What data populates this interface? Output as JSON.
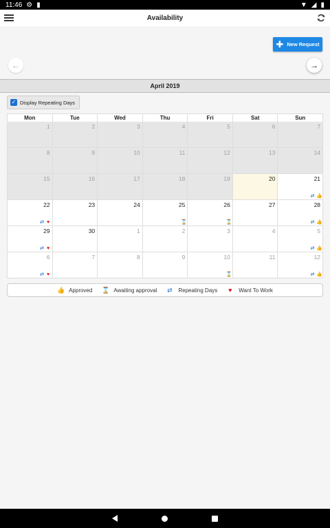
{
  "status_bar": {
    "time": "11:46"
  },
  "app_bar": {
    "title": "Availability"
  },
  "new_request_label": "New Request",
  "month_title": "April 2019",
  "display_repeating_label": "Display Repeating Days",
  "weekdays": [
    "Mon",
    "Tue",
    "Wed",
    "Thu",
    "Fri",
    "Sat",
    "Sun"
  ],
  "weeks": [
    [
      {
        "day": "1",
        "faded": true,
        "state": "grey",
        "icons": []
      },
      {
        "day": "2",
        "faded": true,
        "state": "grey",
        "icons": []
      },
      {
        "day": "3",
        "faded": true,
        "state": "grey",
        "icons": []
      },
      {
        "day": "4",
        "faded": true,
        "state": "grey",
        "icons": []
      },
      {
        "day": "5",
        "faded": true,
        "state": "grey",
        "icons": []
      },
      {
        "day": "6",
        "faded": true,
        "state": "grey",
        "icons": []
      },
      {
        "day": "7",
        "faded": true,
        "state": "grey",
        "icons": []
      }
    ],
    [
      {
        "day": "8",
        "faded": true,
        "state": "grey",
        "icons": []
      },
      {
        "day": "9",
        "faded": true,
        "state": "grey",
        "icons": []
      },
      {
        "day": "10",
        "faded": true,
        "state": "grey",
        "icons": []
      },
      {
        "day": "11",
        "faded": true,
        "state": "grey",
        "icons": []
      },
      {
        "day": "12",
        "faded": true,
        "state": "grey",
        "icons": []
      },
      {
        "day": "13",
        "faded": true,
        "state": "grey",
        "icons": []
      },
      {
        "day": "14",
        "faded": true,
        "state": "grey",
        "icons": []
      }
    ],
    [
      {
        "day": "15",
        "faded": true,
        "state": "grey",
        "icons": []
      },
      {
        "day": "16",
        "faded": true,
        "state": "grey",
        "icons": []
      },
      {
        "day": "17",
        "faded": true,
        "state": "grey",
        "icons": []
      },
      {
        "day": "18",
        "faded": true,
        "state": "grey",
        "icons": []
      },
      {
        "day": "19",
        "faded": true,
        "state": "grey",
        "icons": []
      },
      {
        "day": "20",
        "faded": false,
        "state": "today",
        "icons": []
      },
      {
        "day": "21",
        "faded": false,
        "state": "normal",
        "icons": [
          "repeat",
          "thumb"
        ]
      }
    ],
    [
      {
        "day": "22",
        "faded": false,
        "state": "normal",
        "icons": [
          "repeat",
          "heart"
        ]
      },
      {
        "day": "23",
        "faded": false,
        "state": "normal",
        "icons": []
      },
      {
        "day": "24",
        "faded": false,
        "state": "normal",
        "icons": []
      },
      {
        "day": "25",
        "faded": false,
        "state": "normal",
        "icons": [
          "hourglass"
        ]
      },
      {
        "day": "26",
        "faded": false,
        "state": "normal",
        "icons": [
          "hourglass"
        ]
      },
      {
        "day": "27",
        "faded": false,
        "state": "normal",
        "icons": []
      },
      {
        "day": "28",
        "faded": false,
        "state": "normal",
        "icons": [
          "repeat",
          "thumb"
        ]
      }
    ],
    [
      {
        "day": "29",
        "faded": false,
        "state": "normal",
        "icons": [
          "repeat",
          "heart"
        ]
      },
      {
        "day": "30",
        "faded": false,
        "state": "normal",
        "icons": []
      },
      {
        "day": "1",
        "faded": true,
        "state": "normal",
        "icons": []
      },
      {
        "day": "2",
        "faded": true,
        "state": "normal",
        "icons": []
      },
      {
        "day": "3",
        "faded": true,
        "state": "normal",
        "icons": []
      },
      {
        "day": "4",
        "faded": true,
        "state": "normal",
        "icons": []
      },
      {
        "day": "5",
        "faded": true,
        "state": "normal",
        "icons": [
          "repeat",
          "thumb"
        ]
      }
    ],
    [
      {
        "day": "6",
        "faded": true,
        "state": "normal",
        "icons": [
          "repeat",
          "heart"
        ]
      },
      {
        "day": "7",
        "faded": true,
        "state": "normal",
        "icons": []
      },
      {
        "day": "8",
        "faded": true,
        "state": "normal",
        "icons": []
      },
      {
        "day": "9",
        "faded": true,
        "state": "normal",
        "icons": []
      },
      {
        "day": "10",
        "faded": true,
        "state": "normal",
        "icons": [
          "hourglass"
        ]
      },
      {
        "day": "11",
        "faded": true,
        "state": "normal",
        "icons": []
      },
      {
        "day": "12",
        "faded": true,
        "state": "normal",
        "icons": [
          "repeat",
          "thumb"
        ]
      }
    ]
  ],
  "legend": [
    {
      "icon": "thumb",
      "label": "Approved"
    },
    {
      "icon": "hourglass",
      "label": "Awaiting approval"
    },
    {
      "icon": "repeat",
      "label": "Repeating Days"
    },
    {
      "icon": "heart",
      "label": "Want To Work"
    }
  ],
  "colors": {
    "accent": "#1e88e5",
    "today": "#fcf8e3",
    "past_day": "#e6e6e6",
    "approved": "#7cb342",
    "awaiting": "#f0a020",
    "repeating": "#1e6fd0",
    "want_to_work": "#e0161d"
  }
}
